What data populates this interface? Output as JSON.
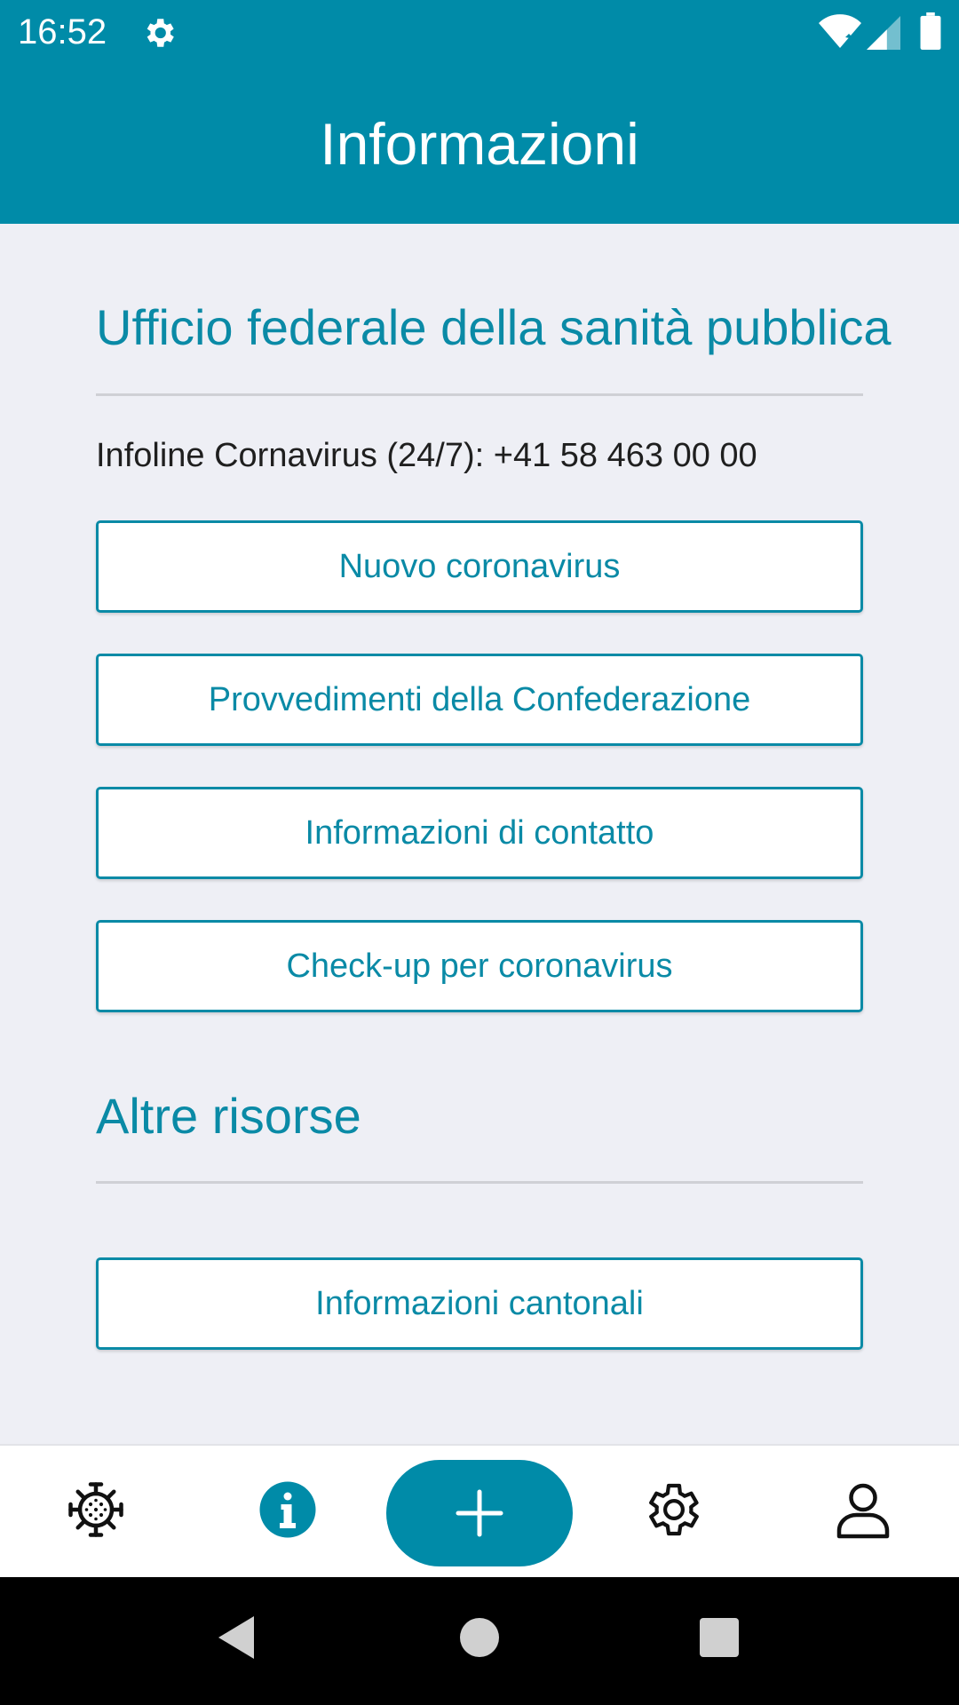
{
  "status_bar": {
    "time": "16:52",
    "icons": [
      "gear-icon",
      "wifi-icon",
      "signal-icon",
      "battery-icon"
    ]
  },
  "app_bar": {
    "title": "Informazioni"
  },
  "sections": {
    "federal": {
      "title": "Ufficio federale della sanità pubblica",
      "infoline": "Infoline Cornavirus (24/7): +41 58 463 00 00",
      "buttons": [
        "Nuovo coronavirus",
        "Provvedimenti della Confederazione",
        "Informazioni di contatto",
        "Check-up per coronavirus"
      ]
    },
    "other": {
      "title": "Altre risorse",
      "buttons": [
        "Informazioni cantonali"
      ]
    }
  },
  "bottom_nav": {
    "items": [
      "virus-icon",
      "info-icon",
      "plus-icon",
      "settings-icon",
      "profile-icon"
    ],
    "active": "info-icon"
  },
  "colors": {
    "primary": "#008ba8",
    "accent_text": "#0a8aa6",
    "background": "#eeeff5"
  },
  "system_nav": {
    "icons": [
      "back-icon",
      "home-icon",
      "recents-icon"
    ]
  }
}
